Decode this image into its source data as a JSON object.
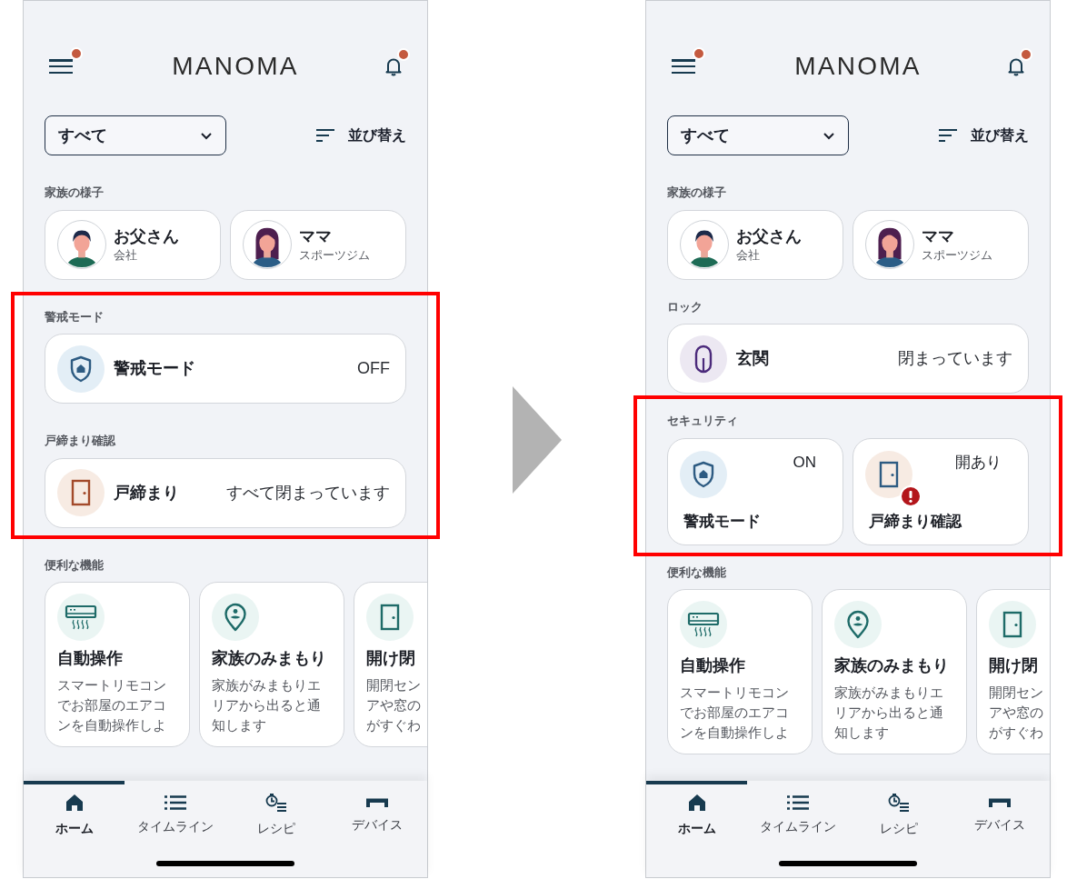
{
  "screens": [
    {
      "menu_badge": true,
      "logo": "MANOMA",
      "bell_badge": true,
      "filter": {
        "value": "すべて"
      },
      "sort": {
        "label": "並び替え"
      },
      "sections": [
        {
          "kind": "family",
          "title": "家族の様子",
          "highlighted": false,
          "items": [
            {
              "kind": "man",
              "name": "お父さん",
              "place": "会社"
            },
            {
              "kind": "woman",
              "name": "ママ",
              "place": "スポーツジム"
            }
          ]
        },
        {
          "kind": "status",
          "title": "警戒モード",
          "highlighted": true,
          "items": [
            {
              "kind": "security",
              "label": "警戒モード",
              "value": "OFF"
            }
          ]
        },
        {
          "kind": "status",
          "title": "戸締まり確認",
          "highlighted": true,
          "items": [
            {
              "kind": "door",
              "label": "戸締まり",
              "value": "すべて閉まっています"
            }
          ]
        },
        {
          "kind": "features",
          "title": "便利な機能",
          "highlighted": false,
          "items": [
            {
              "kind": "aircon",
              "title": "自動操作",
              "lines": [
                "スマートリモコン",
                "でお部屋のエアコ",
                "ンを自動操作しよ"
              ]
            },
            {
              "kind": "pin",
              "title": "家族のみまもり",
              "lines": [
                "家族がみまもりエ",
                "リアから出ると通",
                "知します"
              ]
            },
            {
              "kind": "door",
              "title": "開け閉",
              "lines": [
                "開閉セン",
                "アや窓の",
                "がすぐわ"
              ]
            }
          ]
        }
      ],
      "nav": [
        {
          "kind": "home",
          "label": "ホーム",
          "selected": true
        },
        {
          "kind": "timeline",
          "label": "タイムライン",
          "selected": false
        },
        {
          "kind": "recipe",
          "label": "レシピ",
          "selected": false
        },
        {
          "kind": "device",
          "label": "デバイス",
          "selected": false
        }
      ]
    },
    {
      "menu_badge": true,
      "logo": "MANOMA",
      "bell_badge": true,
      "filter": {
        "value": "すべて"
      },
      "sort": {
        "label": "並び替え"
      },
      "sections": [
        {
          "kind": "family",
          "title": "家族の様子",
          "highlighted": false,
          "items": [
            {
              "kind": "man",
              "name": "お父さん",
              "place": "会社"
            },
            {
              "kind": "woman",
              "name": "ママ",
              "place": "スポーツジム"
            }
          ]
        },
        {
          "kind": "status",
          "title": "ロック",
          "highlighted": false,
          "items": [
            {
              "kind": "lock",
              "label": "玄関",
              "value": "閉まっています"
            }
          ]
        },
        {
          "kind": "tiles",
          "title": "セキュリティ",
          "highlighted": true,
          "items": [
            {
              "kind": "security",
              "label": "警戒モード",
              "value": "ON",
              "alert": false
            },
            {
              "kind": "door",
              "label": "戸締まり確認",
              "value": "開あり",
              "alert": true
            }
          ]
        },
        {
          "kind": "features",
          "title": "便利な機能",
          "highlighted": false,
          "items": [
            {
              "kind": "aircon",
              "title": "自動操作",
              "lines": [
                "スマートリモコン",
                "でお部屋のエアコ",
                "ンを自動操作しよ"
              ]
            },
            {
              "kind": "pin",
              "title": "家族のみまもり",
              "lines": [
                "家族がみまもりエ",
                "リアから出ると通",
                "知します"
              ]
            },
            {
              "kind": "door",
              "title": "開け閉",
              "lines": [
                "開閉セン",
                "アや窓の",
                "がすぐわ"
              ]
            }
          ]
        }
      ],
      "nav": [
        {
          "kind": "home",
          "label": "ホーム",
          "selected": true
        },
        {
          "kind": "timeline",
          "label": "タイムライン",
          "selected": false
        },
        {
          "kind": "recipe",
          "label": "レシピ",
          "selected": false
        },
        {
          "kind": "device",
          "label": "デバイス",
          "selected": false
        }
      ]
    }
  ]
}
